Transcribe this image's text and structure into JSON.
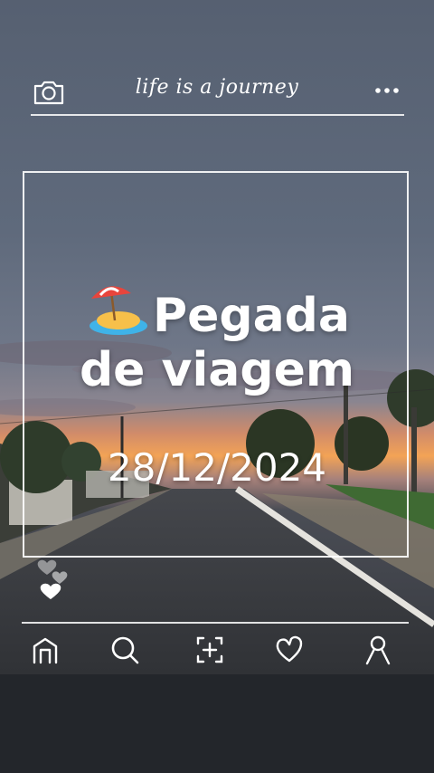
{
  "header": {
    "tagline": "life is a journey",
    "camera_icon": "camera-icon",
    "more_icon": "more-dots-icon"
  },
  "post": {
    "title_line1": "Pegada",
    "title_line2": "de viagem",
    "title_emoji": "desert-island-emoji",
    "date": "28/12/2024"
  },
  "nav": {
    "items": [
      "home-icon",
      "search-icon",
      "add-post-icon",
      "heart-icon",
      "profile-icon"
    ]
  },
  "colors": {
    "sky_top": "#5d6778",
    "sunset": "#f2a45a",
    "text": "#ffffff"
  }
}
